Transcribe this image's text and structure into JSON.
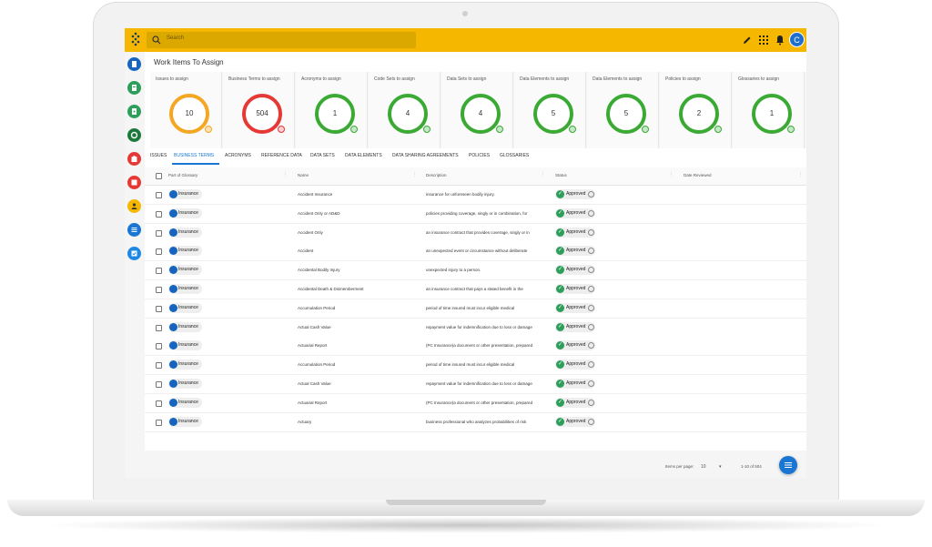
{
  "search": {
    "placeholder": "Search"
  },
  "user": {
    "initial": "C"
  },
  "page_title": "Work Items To Assign",
  "cards": [
    {
      "label": "Issues to assign",
      "value": "10",
      "color": "#f5a623"
    },
    {
      "label": "Business Terms to assign",
      "value": "504",
      "color": "#e53935"
    },
    {
      "label": "Acronyms to assign",
      "value": "1",
      "color": "#3aaa35"
    },
    {
      "label": "Code Sets to assign",
      "value": "4",
      "color": "#3aaa35"
    },
    {
      "label": "Data Sets to assign",
      "value": "4",
      "color": "#3aaa35"
    },
    {
      "label": "Data Elements to assign",
      "value": "5",
      "color": "#3aaa35"
    },
    {
      "label": "Data Elements to assign",
      "value": "5",
      "color": "#3aaa35"
    },
    {
      "label": "Policies to assign",
      "value": "2",
      "color": "#3aaa35"
    },
    {
      "label": "Glossaries to assign",
      "value": "1",
      "color": "#3aaa35"
    }
  ],
  "tabs": [
    "ISSUES",
    "BUSINESS TERMS",
    "ACRONYMS",
    "REFERENCE DATA",
    "DATA SETS",
    "DATA ELEMENTS",
    "DATA SHARING AGREEMENTS",
    "POLICIES",
    "GLOSSARIES"
  ],
  "active_tab": "BUSINESS TERMS",
  "table": {
    "headers": {
      "part_of": "Part of Glossary",
      "name": "Name",
      "description": "Description",
      "status": "Status",
      "date_reviewed": "Date Reviewed"
    },
    "rows": [
      {
        "glossary": "Insurance",
        "name": "Accident Insurance",
        "description": "insurance for unforeseen bodily injury.",
        "status": "Approved"
      },
      {
        "glossary": "Insurance",
        "name": "Accident Only or AD&D",
        "description": "policies providing coverage, singly or in combination, for",
        "status": "Approved"
      },
      {
        "glossary": "Insurance",
        "name": "Accident Only",
        "description": "an insurance contract that provides coverage, singly or in",
        "status": "Approved"
      },
      {
        "glossary": "Insurance",
        "name": "Accident",
        "description": "an unexpected event or circumstance without deliberate",
        "status": "Approved"
      },
      {
        "glossary": "Insurance",
        "name": "Accidental Bodily Injury",
        "description": "unexpected injury to a person.",
        "status": "Approved"
      },
      {
        "glossary": "Insurance",
        "name": "Accidental Death & Dismemberment",
        "description": "an insurance contract that pays a stated benefit in the",
        "status": "Approved"
      },
      {
        "glossary": "Insurance",
        "name": "Accumulation Period",
        "description": "period of time insured must incur eligible medical",
        "status": "Approved"
      },
      {
        "glossary": "Insurance",
        "name": "Actual Cash Value",
        "description": "repayment value for indemnification due to loss or damage",
        "status": "Approved"
      },
      {
        "glossary": "Insurance",
        "name": "Actuarial Report",
        "description": "(PC Insurance)a document or other presentation, prepared",
        "status": "Approved"
      },
      {
        "glossary": "Insurance",
        "name": "Accumulation Period",
        "description": "period of time insured must incur eligible medical",
        "status": "Approved"
      },
      {
        "glossary": "Insurance",
        "name": "Actual Cash Value",
        "description": "repayment value for indemnification due to loss or damage",
        "status": "Approved"
      },
      {
        "glossary": "Insurance",
        "name": "Actuarial Report",
        "description": "(PC Insurance)a document or other presentation, prepared",
        "status": "Approved"
      },
      {
        "glossary": "Insurance",
        "name": "Actuary",
        "description": "business professional who analyzes probabilities of risk",
        "status": "Approved"
      }
    ]
  },
  "pagination": {
    "items_per_page_label": "Items per page:",
    "items_per_page": "10",
    "range": "1-10 of 504"
  },
  "colors": {
    "topbar": "#f5b700",
    "accent": "#1976d2",
    "approved": "#2e9e5b"
  },
  "sidenav_icons": [
    {
      "name": "glossary-icon",
      "color": "#1565c0"
    },
    {
      "name": "report-icon",
      "color": "#2e9e5b"
    },
    {
      "name": "document-icon",
      "color": "#2e9e5b"
    },
    {
      "name": "policy-icon",
      "color": "#1b7a3a"
    },
    {
      "name": "building-icon",
      "color": "#e53935"
    },
    {
      "name": "book-icon",
      "color": "#e53935"
    },
    {
      "name": "user-icon",
      "color": "#f5b700"
    },
    {
      "name": "list-icon",
      "color": "#1976d2"
    },
    {
      "name": "checklist-icon",
      "color": "#1e88e5"
    }
  ]
}
